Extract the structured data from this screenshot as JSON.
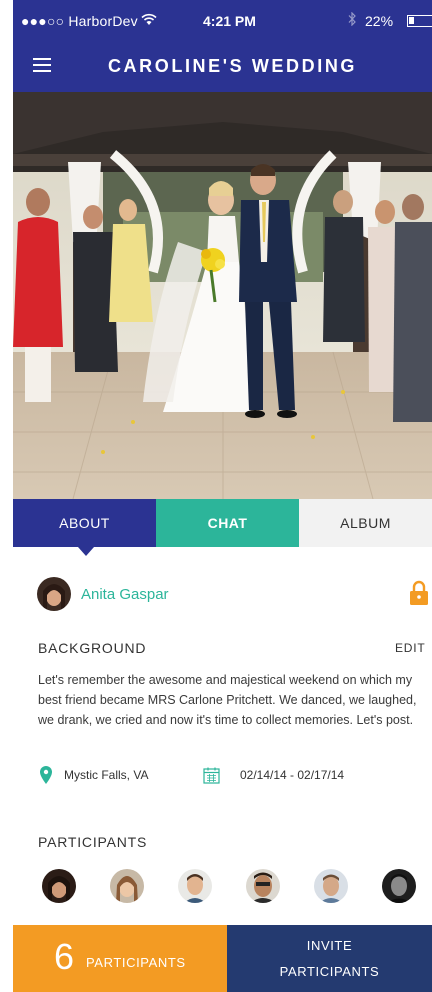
{
  "status_bar": {
    "carrier": "●●●○○ HarborDev",
    "wifi_icon": "wifi-icon",
    "time": "4:21 PM",
    "bluetooth_icon": "bluetooth-icon",
    "battery_percent": "22%",
    "battery_level": 0.22
  },
  "nav": {
    "menu_icon": "hamburger-menu-icon",
    "title": "CAROLINE'S WEDDING"
  },
  "hero": {
    "image": "wedding couple walking down aisle between applauding guests under gazebo"
  },
  "tabs": [
    {
      "label": "ABOUT",
      "active": true
    },
    {
      "label": "CHAT",
      "active": false
    },
    {
      "label": "ALBUM",
      "active": false
    }
  ],
  "host": {
    "name": "Anita Gaspar",
    "lock_icon": "lock-icon"
  },
  "background": {
    "title": "BACKGROUND",
    "edit_label": "EDIT",
    "text": "Let's remember the awesome and majestical weekend on which my best friend became MRS Carlone Pritchett. We danced, we laughed, we drank, we cried and now it's time to collect memories. Let's post.",
    "location": "Mystic Falls, VA",
    "location_icon": "map-pin-icon",
    "calendar_icon": "calendar-icon",
    "dates": "02/14/14 - 02/17/14"
  },
  "participants": {
    "title": "PARTICIPANTS",
    "count": "6",
    "count_label": "PARTICIPANTS",
    "invite_line1": "INVITE",
    "invite_line2": "PARTICIPANTS"
  },
  "colors": {
    "primary": "#2b3392",
    "teal": "#2cb59a",
    "orange": "#f39b23",
    "navy": "#243a70",
    "light_tab": "#f2f2f2"
  }
}
